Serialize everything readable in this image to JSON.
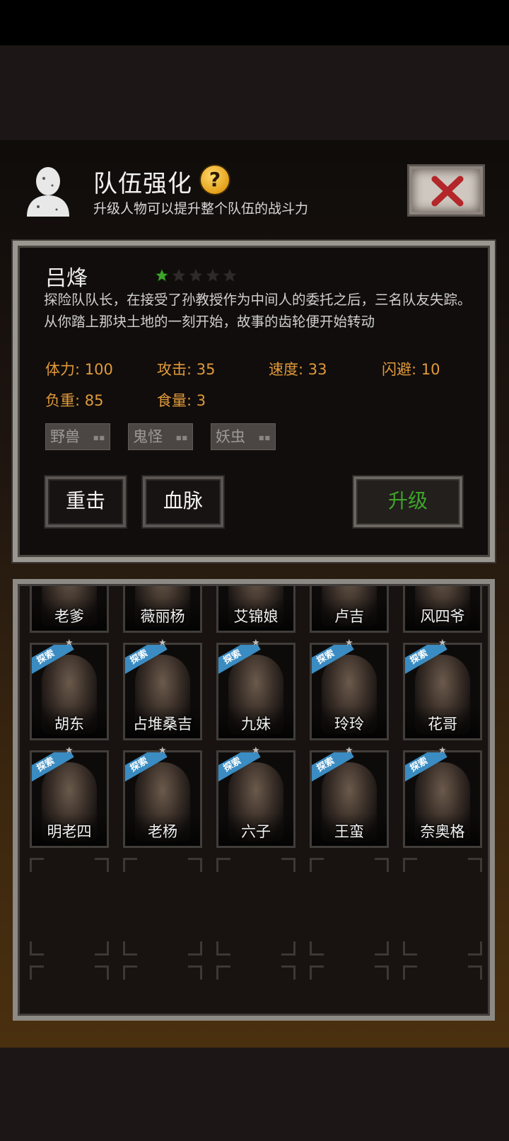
{
  "header": {
    "title": "队伍强化",
    "help_icon": "question-icon",
    "subtitle": "升级人物可以提升整个队伍的战斗力",
    "close_icon": "close-x-icon"
  },
  "character": {
    "name": "吕烽",
    "stars_filled": 1,
    "stars_total": 5,
    "description": "探险队队长，在接受了孙教授作为中间人的委托之后，三名队友失踪。从你踏上那块土地的一刻开始，故事的齿轮便开始转动",
    "stats": {
      "stamina": "体力: 100",
      "attack": "攻击: 35",
      "speed": "速度: 33",
      "dodge": "闪避: 10",
      "load": "负重: 85",
      "food": "食量: 3"
    },
    "tags": [
      "野兽",
      "鬼怪",
      "妖虫"
    ]
  },
  "actions": {
    "heavy_strike": "重击",
    "bloodline": "血脉",
    "upgrade": "升级"
  },
  "roster": {
    "row1": [
      "老爹",
      "薇丽杨",
      "艾锦娘",
      "卢吉",
      "风四爷"
    ],
    "row2": [
      "胡东",
      "占堆桑吉",
      "九妹",
      "玲玲",
      "花哥"
    ],
    "row3": [
      "明老四",
      "老杨",
      "六子",
      "王蛮",
      "奈奥格"
    ],
    "explore_badge": "探索"
  },
  "colors": {
    "stat_text": "#e09a3a",
    "upgrade_text": "#3fa52a",
    "star_active": "#3fa52a",
    "badge_blue": "#3a8cc2"
  }
}
